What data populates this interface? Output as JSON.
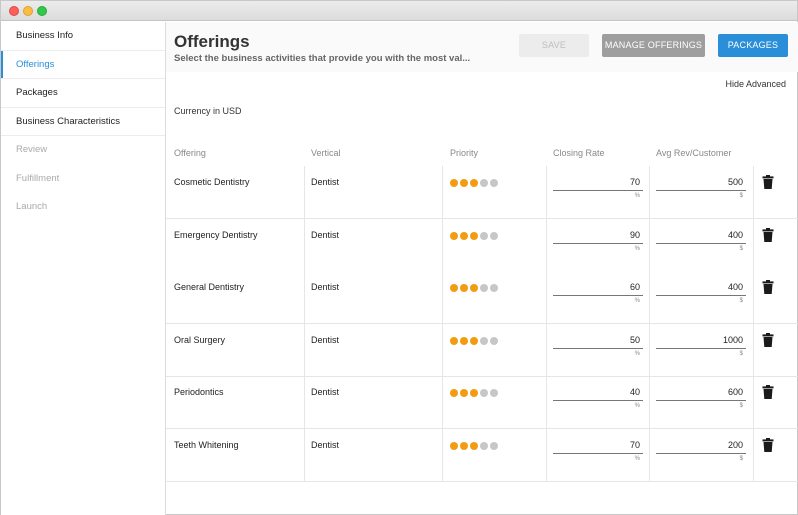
{
  "sidebar": {
    "items": [
      {
        "label": "Business Info",
        "state": "normal"
      },
      {
        "label": "Offerings",
        "state": "active"
      },
      {
        "label": "Packages",
        "state": "normal"
      },
      {
        "label": "Business Characteristics",
        "state": "normal"
      },
      {
        "label": "Review",
        "state": "disabled"
      },
      {
        "label": "Fulfillment",
        "state": "disabled"
      },
      {
        "label": "Launch",
        "state": "disabled"
      }
    ]
  },
  "header": {
    "title": "Offerings",
    "subtitle": "Select the business activities that provide you with the most val...",
    "save_label": "SAVE",
    "manage_label": "MANAGE OFFERINGS",
    "packages_label": "PACKAGES"
  },
  "hide_advanced": "Hide Advanced",
  "currency": "Currency in USD",
  "columns": {
    "offering": "Offering",
    "vertical": "Vertical",
    "priority": "Priority",
    "closing_rate": "Closing Rate",
    "avg_rev": "Avg Rev/Customer"
  },
  "rate_unit": "%",
  "rev_unit": "$",
  "offerings": [
    {
      "name": "Cosmetic Dentistry",
      "vertical": "Dentist",
      "priority": 3,
      "closing_rate": "70",
      "avg_rev": "500"
    },
    {
      "name": "Emergency Dentistry",
      "vertical": "Dentist",
      "priority": 3,
      "closing_rate": "90",
      "avg_rev": "400"
    },
    {
      "name": "General Dentistry",
      "vertical": "Dentist",
      "priority": 3,
      "closing_rate": "60",
      "avg_rev": "400"
    },
    {
      "name": "Oral Surgery",
      "vertical": "Dentist",
      "priority": 3,
      "closing_rate": "50",
      "avg_rev": "1000"
    },
    {
      "name": "Periodontics",
      "vertical": "Dentist",
      "priority": 3,
      "closing_rate": "40",
      "avg_rev": "600"
    },
    {
      "name": "Teeth Whitening",
      "vertical": "Dentist",
      "priority": 3,
      "closing_rate": "70",
      "avg_rev": "200"
    }
  ],
  "priority_max": 5,
  "colors": {
    "accent": "#2a8fd8",
    "priority_on": "#f39c12",
    "priority_off": "#c7c7c7"
  },
  "icons": {
    "delete": "trash-icon"
  }
}
